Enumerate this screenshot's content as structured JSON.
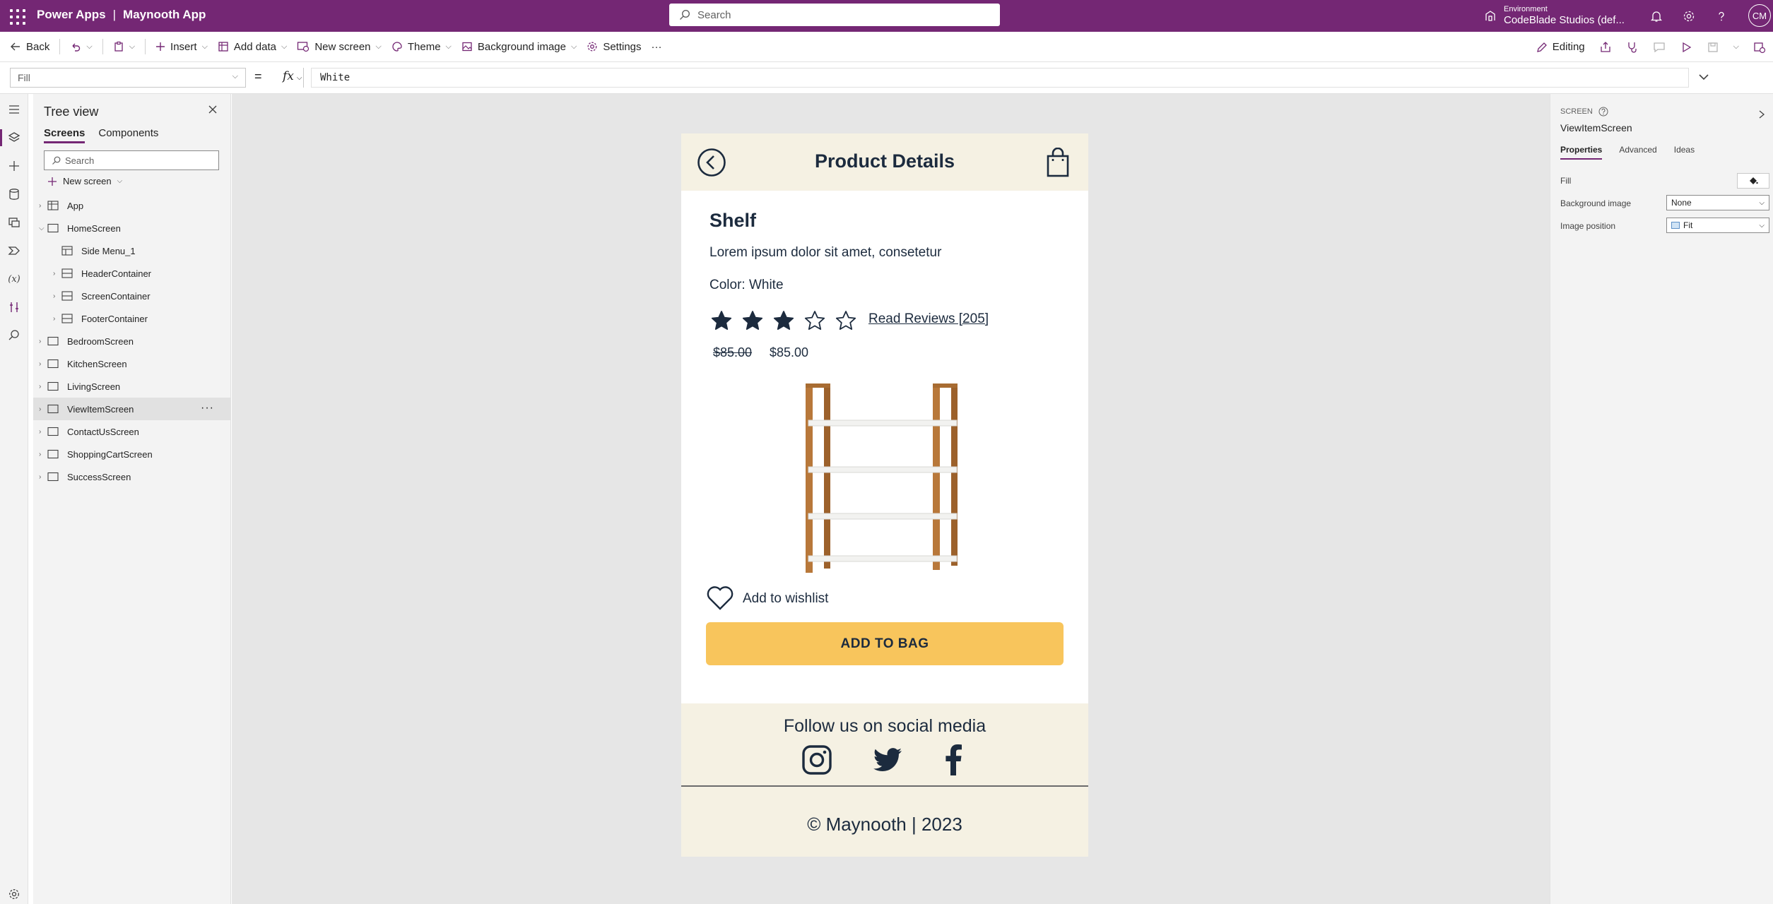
{
  "app": {
    "product": "Power Apps",
    "separator": "|",
    "name": "Maynooth App"
  },
  "topbar": {
    "search_placeholder": "Search",
    "environment_label": "Environment",
    "environment_value": "CodeBlade Studios (def...",
    "avatar_initials": "CM",
    "icons": [
      "building-icon",
      "bell-icon",
      "gear-icon",
      "help-icon"
    ]
  },
  "commandbar": {
    "back": "Back",
    "insert": "Insert",
    "add_data": "Add data",
    "new_screen": "New screen",
    "theme": "Theme",
    "background_image": "Background image",
    "settings": "Settings",
    "more": "···",
    "editing": "Editing"
  },
  "formula": {
    "property": "Fill",
    "equals": "=",
    "fx": "fx",
    "value": "White"
  },
  "tree": {
    "title": "Tree view",
    "tabs": [
      "Screens",
      "Components"
    ],
    "search_placeholder": "Search",
    "new_screen": "New screen",
    "items": [
      {
        "label": "App",
        "level": 0,
        "icon": "app-icon",
        "expandable": true
      },
      {
        "label": "HomeScreen",
        "level": 0,
        "icon": "screen-icon",
        "expanded": true
      },
      {
        "label": "Side Menu_1",
        "level": 1,
        "icon": "component-icon",
        "expandable": false
      },
      {
        "label": "HeaderContainer",
        "level": 1,
        "icon": "container-icon",
        "expandable": true
      },
      {
        "label": "ScreenContainer",
        "level": 1,
        "icon": "container-icon",
        "expandable": true
      },
      {
        "label": "FooterContainer",
        "level": 1,
        "icon": "container-icon",
        "expandable": true
      },
      {
        "label": "BedroomScreen",
        "level": 0,
        "icon": "screen-icon",
        "expandable": true
      },
      {
        "label": "KitchenScreen",
        "level": 0,
        "icon": "screen-icon",
        "expandable": true
      },
      {
        "label": "LivingScreen",
        "level": 0,
        "icon": "screen-icon",
        "expandable": true
      },
      {
        "label": "ViewItemScreen",
        "level": 0,
        "icon": "screen-icon",
        "expandable": true,
        "selected": true
      },
      {
        "label": "ContactUsScreen",
        "level": 0,
        "icon": "screen-icon",
        "expandable": true
      },
      {
        "label": "ShoppingCartScreen",
        "level": 0,
        "icon": "screen-icon",
        "expandable": true
      },
      {
        "label": "SuccessScreen",
        "level": 0,
        "icon": "screen-icon",
        "expandable": true
      }
    ],
    "more": "···"
  },
  "phone": {
    "header_title": "Product Details",
    "product_name": "Shelf",
    "description": "Lorem ipsum dolor sit amet, consetetur",
    "color": "Color: White",
    "rating": 3,
    "rating_max": 5,
    "reviews": "Read Reviews [205]",
    "price_old": "$85.00",
    "price_new": "$85.00",
    "wishlist": "Add to wishlist",
    "add_to_bag": "ADD TO BAG",
    "follow": "Follow us on social media",
    "copyright": "© Maynooth | 2023",
    "colors": {
      "navy": "#1c2b3e",
      "cream": "#f5f1e3",
      "button": "#f8c55c"
    }
  },
  "properties": {
    "caption": "SCREEN",
    "screen_name": "ViewItemScreen",
    "tabs": [
      "Properties",
      "Advanced",
      "Ideas"
    ],
    "fill_label": "Fill",
    "bg_label": "Background image",
    "bg_value": "None",
    "pos_label": "Image position",
    "pos_value": "Fit"
  },
  "colors": {
    "brand": "#742774"
  }
}
